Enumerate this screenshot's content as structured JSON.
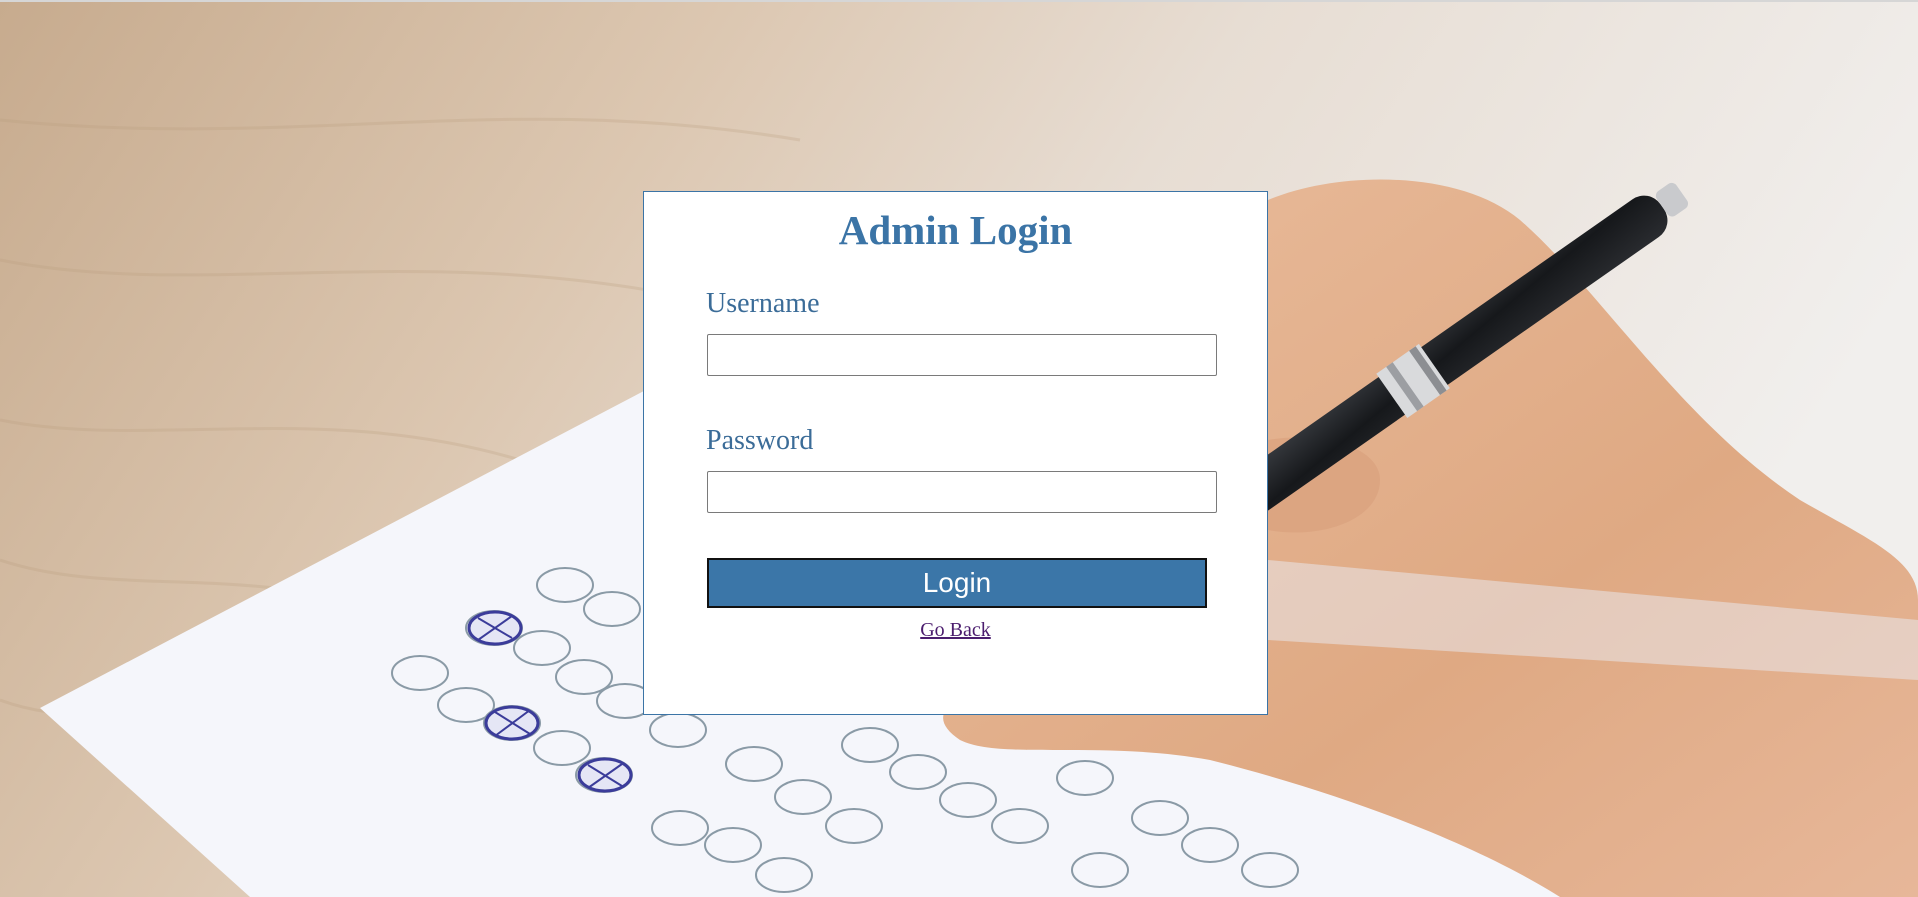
{
  "page": {
    "background_description_colors": {
      "desk": "#cdb59c",
      "paper": "#f4f5fa",
      "skin": "#e2b08e",
      "pen": "#1f2226"
    }
  },
  "login": {
    "title": "Admin Login",
    "username_label": "Username",
    "username_value": "",
    "password_label": "Password",
    "password_value": "",
    "button_label": "Login",
    "go_back_label": "Go Back"
  },
  "colors": {
    "accent": "#3b76a8",
    "label": "#3b6c98",
    "link_visited": "#4b1d6e"
  },
  "icons": {
    "background": "answer-sheet-photo-icon"
  }
}
